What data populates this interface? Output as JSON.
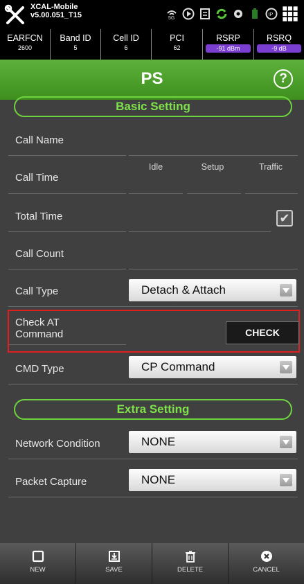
{
  "status_bar": {
    "app_name": "XCAL-Mobile",
    "version": "v5.00.051_T15"
  },
  "info_row": [
    {
      "label": "EARFCN",
      "value": "2600",
      "highlighted": false
    },
    {
      "label": "Band ID",
      "value": "5",
      "highlighted": false
    },
    {
      "label": "Cell ID",
      "value": "6",
      "highlighted": false
    },
    {
      "label": "PCI",
      "value": "62",
      "highlighted": false
    },
    {
      "label": "RSRP",
      "value": "-91 dBm",
      "highlighted": true
    },
    {
      "label": "RSRQ",
      "value": "-9 dB",
      "highlighted": true
    }
  ],
  "header": {
    "title": "PS",
    "help_symbol": "?"
  },
  "sections": {
    "basic": "Basic Setting",
    "extra": "Extra Setting"
  },
  "fields": {
    "call_name": "Call Name",
    "call_time": "Call Time",
    "call_time_sub": [
      "Idle",
      "Setup",
      "Traffic"
    ],
    "total_time": "Total Time",
    "call_count": "Call Count",
    "call_type": "Call Type",
    "call_type_value": "Detach & Attach",
    "check_at": "Check AT\nCommand",
    "check_button": "CHECK",
    "cmd_type": "CMD Type",
    "cmd_type_value": "CP Command",
    "network_condition": "Network Condition",
    "network_condition_value": "NONE",
    "packet_capture": "Packet Capture",
    "packet_capture_value": "NONE"
  },
  "bottom_bar": {
    "new": "NEW",
    "save": "SAVE",
    "delete": "DELETE",
    "cancel": "CANCEL"
  },
  "colors": {
    "header_green": "#4ea22c",
    "section_green": "#6fd43f",
    "pill_purple": "#7a3fd0",
    "highlight_red": "#e02020"
  }
}
